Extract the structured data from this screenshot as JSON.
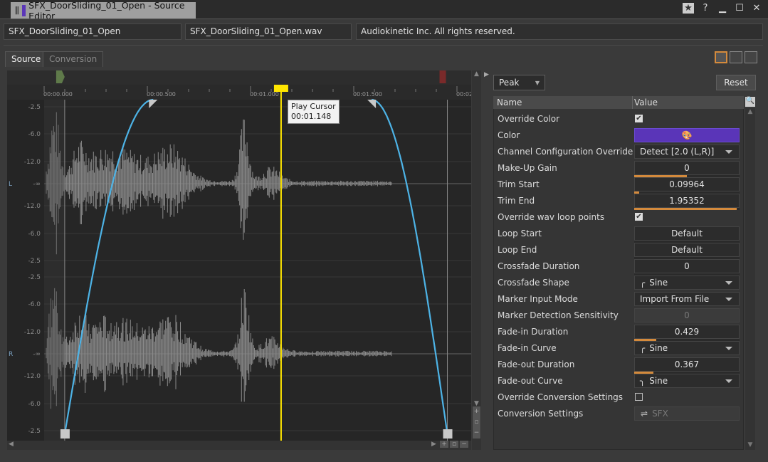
{
  "window": {
    "title": "SFX_DoorSliding_01_Open - Source Editor",
    "swatch_color": "#5a35b8"
  },
  "header": {
    "object_name": "SFX_DoorSliding_01_Open",
    "file_name": "SFX_DoorSliding_01_Open.wav",
    "copyright": "Audiokinetic Inc. All rights reserved."
  },
  "tabs": [
    {
      "label": "Source",
      "active": true
    },
    {
      "label": "Conversion",
      "active": false
    }
  ],
  "waveform": {
    "time_ticks": [
      "00:00.000",
      "00:00.500",
      "00:01.000",
      "00:01.500",
      "00:02"
    ],
    "db_labels": [
      "-2.5",
      "-6.0",
      "-12.0",
      "-∞",
      "-12.0",
      "-6.0",
      "-2.5"
    ],
    "channels": [
      "L",
      "R"
    ],
    "play_cursor": {
      "label": "Play Cursor",
      "time": "00:01.148",
      "seconds": 1.148
    },
    "trim_start": 0.09964,
    "trim_end": 1.95352,
    "fade_in": 0.429,
    "fade_out": 0.367,
    "fade_color": "#4db3e6",
    "cursor_color": "#ffe600"
  },
  "right_panel": {
    "view_mode": "Peak",
    "reset_label": "Reset",
    "columns": [
      "Name",
      "Value"
    ],
    "properties": [
      {
        "name": "Override Color",
        "type": "check",
        "checked": true
      },
      {
        "name": "Color",
        "type": "color",
        "color": "#5a35b8"
      },
      {
        "name": "Channel Configuration Override",
        "type": "dropdown",
        "value": "Detect [2.0 (L,R)]"
      },
      {
        "name": "Make-Up Gain",
        "type": "number",
        "value": "0",
        "fill": 0.5
      },
      {
        "name": "Trim Start",
        "type": "number",
        "value": "0.09964",
        "fill": 0.05
      },
      {
        "name": "Trim End",
        "type": "number",
        "value": "1.95352",
        "fill": 0.97
      },
      {
        "name": "Override wav loop points",
        "type": "check",
        "checked": true
      },
      {
        "name": "Loop Start",
        "type": "number",
        "value": "Default",
        "fill": 0
      },
      {
        "name": "Loop End",
        "type": "number",
        "value": "Default",
        "fill": 0
      },
      {
        "name": "Crossfade Duration",
        "type": "number",
        "value": "0",
        "fill": 0
      },
      {
        "name": "Crossfade Shape",
        "type": "dropdown",
        "value": "Sine",
        "icon": "curve-in"
      },
      {
        "name": "Marker Input Mode",
        "type": "dropdown",
        "value": "Import From File"
      },
      {
        "name": "Marker Detection Sensitivity",
        "type": "disabled",
        "value": "0"
      },
      {
        "name": "Fade-in Duration",
        "type": "number",
        "value": "0.429",
        "fill": 0.21
      },
      {
        "name": "Fade-in Curve",
        "type": "dropdown",
        "value": "Sine",
        "icon": "curve-in"
      },
      {
        "name": "Fade-out Duration",
        "type": "number",
        "value": "0.367",
        "fill": 0.18
      },
      {
        "name": "Fade-out Curve",
        "type": "dropdown",
        "value": "Sine",
        "icon": "curve-out"
      },
      {
        "name": "Override Conversion Settings",
        "type": "check",
        "checked": false
      },
      {
        "name": "Conversion Settings",
        "type": "disabled-ref",
        "value": "SFX"
      }
    ]
  }
}
